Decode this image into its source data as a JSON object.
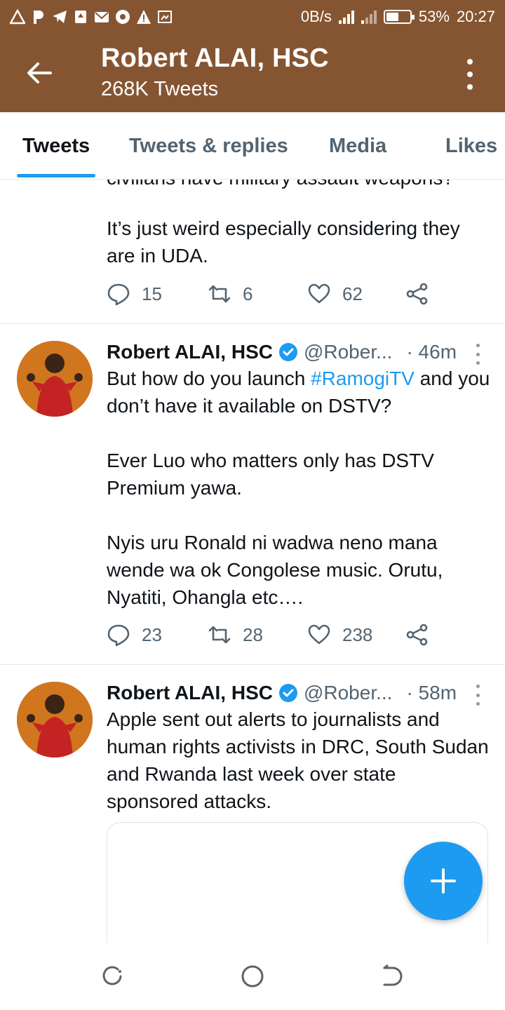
{
  "status_bar": {
    "network_speed": "0B/s",
    "battery": "53%",
    "battery_level": 0.53,
    "time": "20:27",
    "notification_icons": [
      "warning-triangle-icon",
      "p-icon",
      "telegram-icon",
      "download-icon",
      "mail-icon",
      "chrome-icon",
      "alert-icon",
      "screenshot-icon"
    ]
  },
  "header": {
    "title": "Robert ALAI, HSC",
    "subtitle": "268K Tweets"
  },
  "tabs": [
    {
      "label": "Tweets",
      "active": true
    },
    {
      "label": "Tweets & replies",
      "active": false
    },
    {
      "label": "Media",
      "active": false
    },
    {
      "label": "Likes",
      "active": false
    }
  ],
  "tweets": [
    {
      "clipped_first_line": "civilians have military assault weapons?",
      "text": "It’s just weird especially considering they are in UDA.",
      "replies": "15",
      "retweets": "6",
      "likes": "62"
    },
    {
      "name": "Robert ALAI, HSC",
      "handle": "@Rober...",
      "time": "· 46m",
      "text_before_hashtag": "But how do you launch ",
      "hashtag": "#RamogiTV",
      "text_after_hashtag": " and you don’t have it available on DSTV?",
      "paragraph2": "Ever Luo who matters only has DSTV Premium yawa.",
      "paragraph3": "Nyis uru Ronald ni wadwa neno mana wende wa ok Congolese music. Orutu, Nyatiti, Ohangla etc….",
      "replies": "23",
      "retweets": "28",
      "likes": "238"
    },
    {
      "name": "Robert ALAI, HSC",
      "handle": "@Rober...",
      "time": "· 58m",
      "text": "Apple sent out alerts to journalists and human rights activists in DRC, South Sudan and Rwanda last week over state sponsored attacks."
    }
  ],
  "colors": {
    "header_bg": "#855532",
    "accent": "#1d9bf0",
    "secondary_text": "#536471"
  }
}
